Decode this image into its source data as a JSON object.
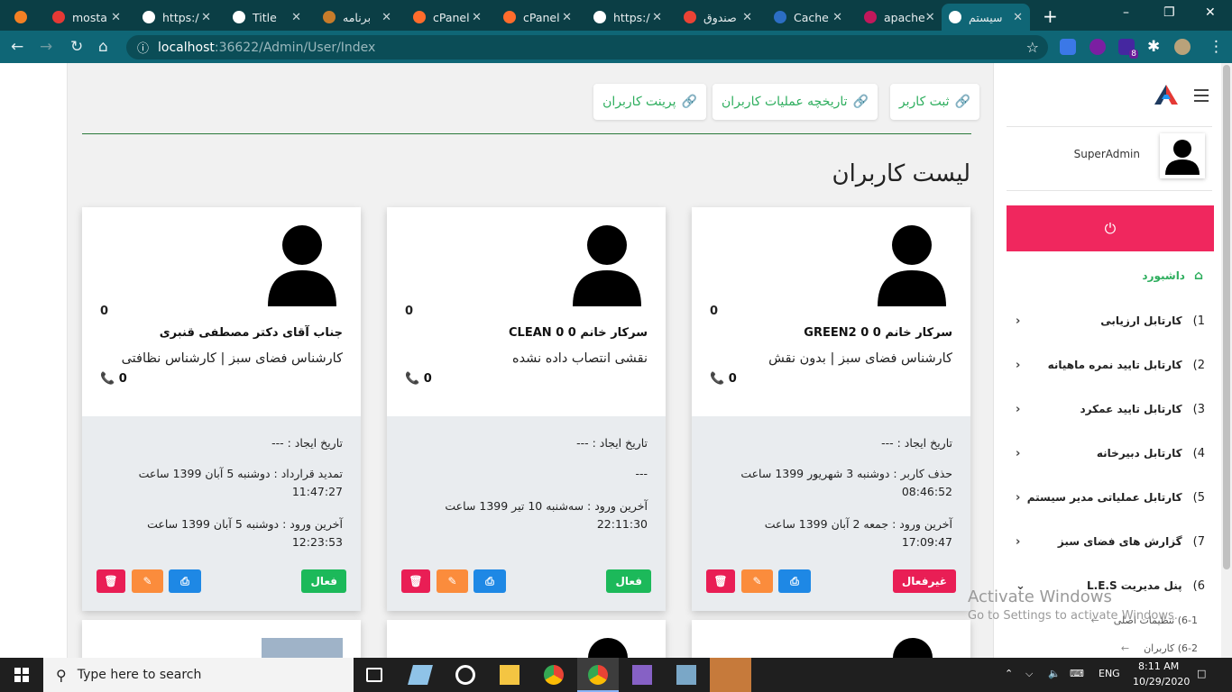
{
  "browser": {
    "tabs": [
      {
        "title": "",
        "icon": "stackoverflow-icon",
        "color": "#f48024"
      },
      {
        "title": "mosta",
        "icon": "g-icon",
        "color": "#e53935"
      },
      {
        "title": "https:/",
        "icon": "globe-icon",
        "color": "#fff"
      },
      {
        "title": "Title",
        "icon": "globe-icon",
        "color": "#fff"
      },
      {
        "title": "برنامه",
        "icon": "app-icon",
        "color": "#c77c2b"
      },
      {
        "title": "cPanel",
        "icon": "cpanel-icon",
        "color": "#ff6c2c"
      },
      {
        "title": "cPanel",
        "icon": "cpanel-icon",
        "color": "#ff6c2c"
      },
      {
        "title": "https:/",
        "icon": "globe-icon",
        "color": "#fff"
      },
      {
        "title": "صندوق",
        "icon": "gmail-icon",
        "color": "#ea4335"
      },
      {
        "title": "Cache",
        "icon": "cache-icon",
        "color": "#2c6ec4"
      },
      {
        "title": "apache",
        "icon": "feather-icon",
        "color": "#c2185b"
      },
      {
        "title": "سیستم",
        "icon": "globe-icon",
        "color": "#fff"
      }
    ],
    "url_host": "localhost",
    "url_path": ":36622/Admin/User/Index",
    "extension_badge": "8"
  },
  "toolbar": {
    "register_label": "ثبت کاربر",
    "history_label": "تاریخچه عملیات کاربران",
    "print_label": "پرینت کاربران"
  },
  "page_title": "لیست کاربران",
  "cards": [
    {
      "count": "0",
      "name": "سرکار خانم 0 0 GREEN2",
      "role": "کارشناس فضای سبز | بدون نقش",
      "phone": "0",
      "created": "تاریخ ایجاد : ---",
      "line2": "حذف کاربر : دوشنبه 3 شهریور 1399 ساعت 08:46:52",
      "line3": "آخرین ورود : جمعه 2 آبان 1399 ساعت 17:09:47",
      "status": "غیرفعال",
      "status_color": "#e91e55"
    },
    {
      "count": "0",
      "name": "سرکار خانم 0 0 CLEAN",
      "role": "نقشی انتصاب داده نشده",
      "phone": "0",
      "created": "تاریخ ایجاد : ---",
      "line2": "---",
      "line3": "آخرین ورود : سه‌شنبه 10 تیر 1399 ساعت 22:11:30",
      "status": "فعال",
      "status_color": "#1cb95a"
    },
    {
      "count": "0",
      "name": "جناب آقای دکتر مصطفی قنبری",
      "role": "کارشناس فضای سبز | کارشناس نظافتی",
      "phone": "0",
      "created": "تاریخ ایجاد : ---",
      "line2": "تمدید قرارداد : دوشنبه 5 آبان 1399 ساعت 11:47:27",
      "line3": "آخرین ورود : دوشنبه 5 آبان 1399 ساعت 12:23:53",
      "status": "فعال",
      "status_color": "#1cb95a"
    }
  ],
  "sidebar": {
    "username": "SuperAdmin",
    "dashboard": "داشبورد",
    "items": [
      {
        "num": "1)",
        "label": "کارتابل ارزیابی"
      },
      {
        "num": "2)",
        "label": "کارتابل تایید نمره ماهیانه"
      },
      {
        "num": "3)",
        "label": "کارتابل تایید عمکرد"
      },
      {
        "num": "4)",
        "label": "کارتابل دبیرخانه"
      },
      {
        "num": "5)",
        "label": "کارتابل عملیاتی مدیر سیستم"
      },
      {
        "num": "7)",
        "label": "گزارش های فضای سبز"
      },
      {
        "num": "6)",
        "label": "پنل مدیریت L.E.S"
      }
    ],
    "subitems": [
      {
        "label": "6-1) تنظیمات اصلی"
      },
      {
        "label": "6-2) کاربران"
      }
    ]
  },
  "watermark": {
    "title": "Activate Windows",
    "subtitle": "Go to Settings to activate Windows."
  },
  "taskbar": {
    "search_placeholder": "Type here to search",
    "lang": "ENG",
    "time": "8:11 AM",
    "date": "10/29/2020"
  }
}
